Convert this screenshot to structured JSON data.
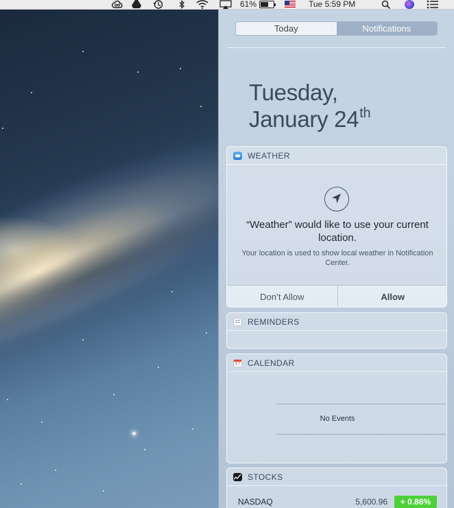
{
  "menubar": {
    "battery_percent_text": "61%",
    "battery_level": 0.61,
    "clock": "Tue 5:59 PM",
    "icons": [
      "creative-cloud-icon",
      "google-drive-icon",
      "time-machine-icon",
      "bluetooth-icon",
      "wifi-icon",
      "airplay-icon",
      "battery-icon",
      "us-flag-icon",
      "spotlight-icon",
      "siri-icon",
      "notification-center-icon"
    ]
  },
  "notification_center": {
    "tabs": [
      {
        "label": "Today",
        "active": true
      },
      {
        "label": "Notifications",
        "active": false
      }
    ],
    "date_line1": "Tuesday,",
    "date_line2": "January 24",
    "date_suffix": "th"
  },
  "weather": {
    "title": "WEATHER",
    "headline": "“Weather” would like to use your current location.",
    "subtext": "Your location is used to show local weather in Notification Center.",
    "deny_label": "Don’t Allow",
    "allow_label": "Allow"
  },
  "reminders": {
    "title": "REMINDERS"
  },
  "calendar": {
    "title": "CALENDAR",
    "icon_day": "17",
    "empty_text": "No Events"
  },
  "stocks": {
    "title": "STOCKS",
    "rows": [
      {
        "name": "NASDAQ",
        "price": "5,600.96",
        "change": "+ 0.86%",
        "change_color": "#4cd137"
      }
    ]
  }
}
